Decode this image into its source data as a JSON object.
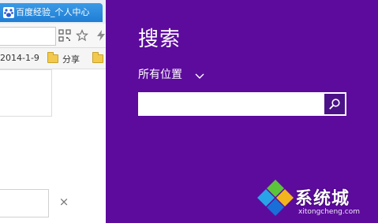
{
  "browser": {
    "tab": {
      "title": "百度经验_个人中心"
    },
    "bookmarks": [
      {
        "label": "2014-1-9"
      },
      {
        "label": "分享"
      }
    ],
    "close_glyph": "×"
  },
  "charm": {
    "title": "搜索",
    "scope_label": "所有位置",
    "search": {
      "value": "",
      "placeholder": ""
    }
  },
  "watermark": {
    "brand": "系统城",
    "sub": "xitongcheng.com"
  },
  "colors": {
    "charm_background": "#5d0b9d",
    "search_button": "#4b1288",
    "tab_blue": "#2b8ae0"
  },
  "icons": {
    "tab_favicon": "baidu-paw-icon",
    "qr": "qr-code-icon",
    "star": "star-icon",
    "bolt": "lightning-icon",
    "scope_chevron": "chevron-down-icon",
    "search": "magnifier-icon",
    "logo": "windows-logo-icon"
  }
}
